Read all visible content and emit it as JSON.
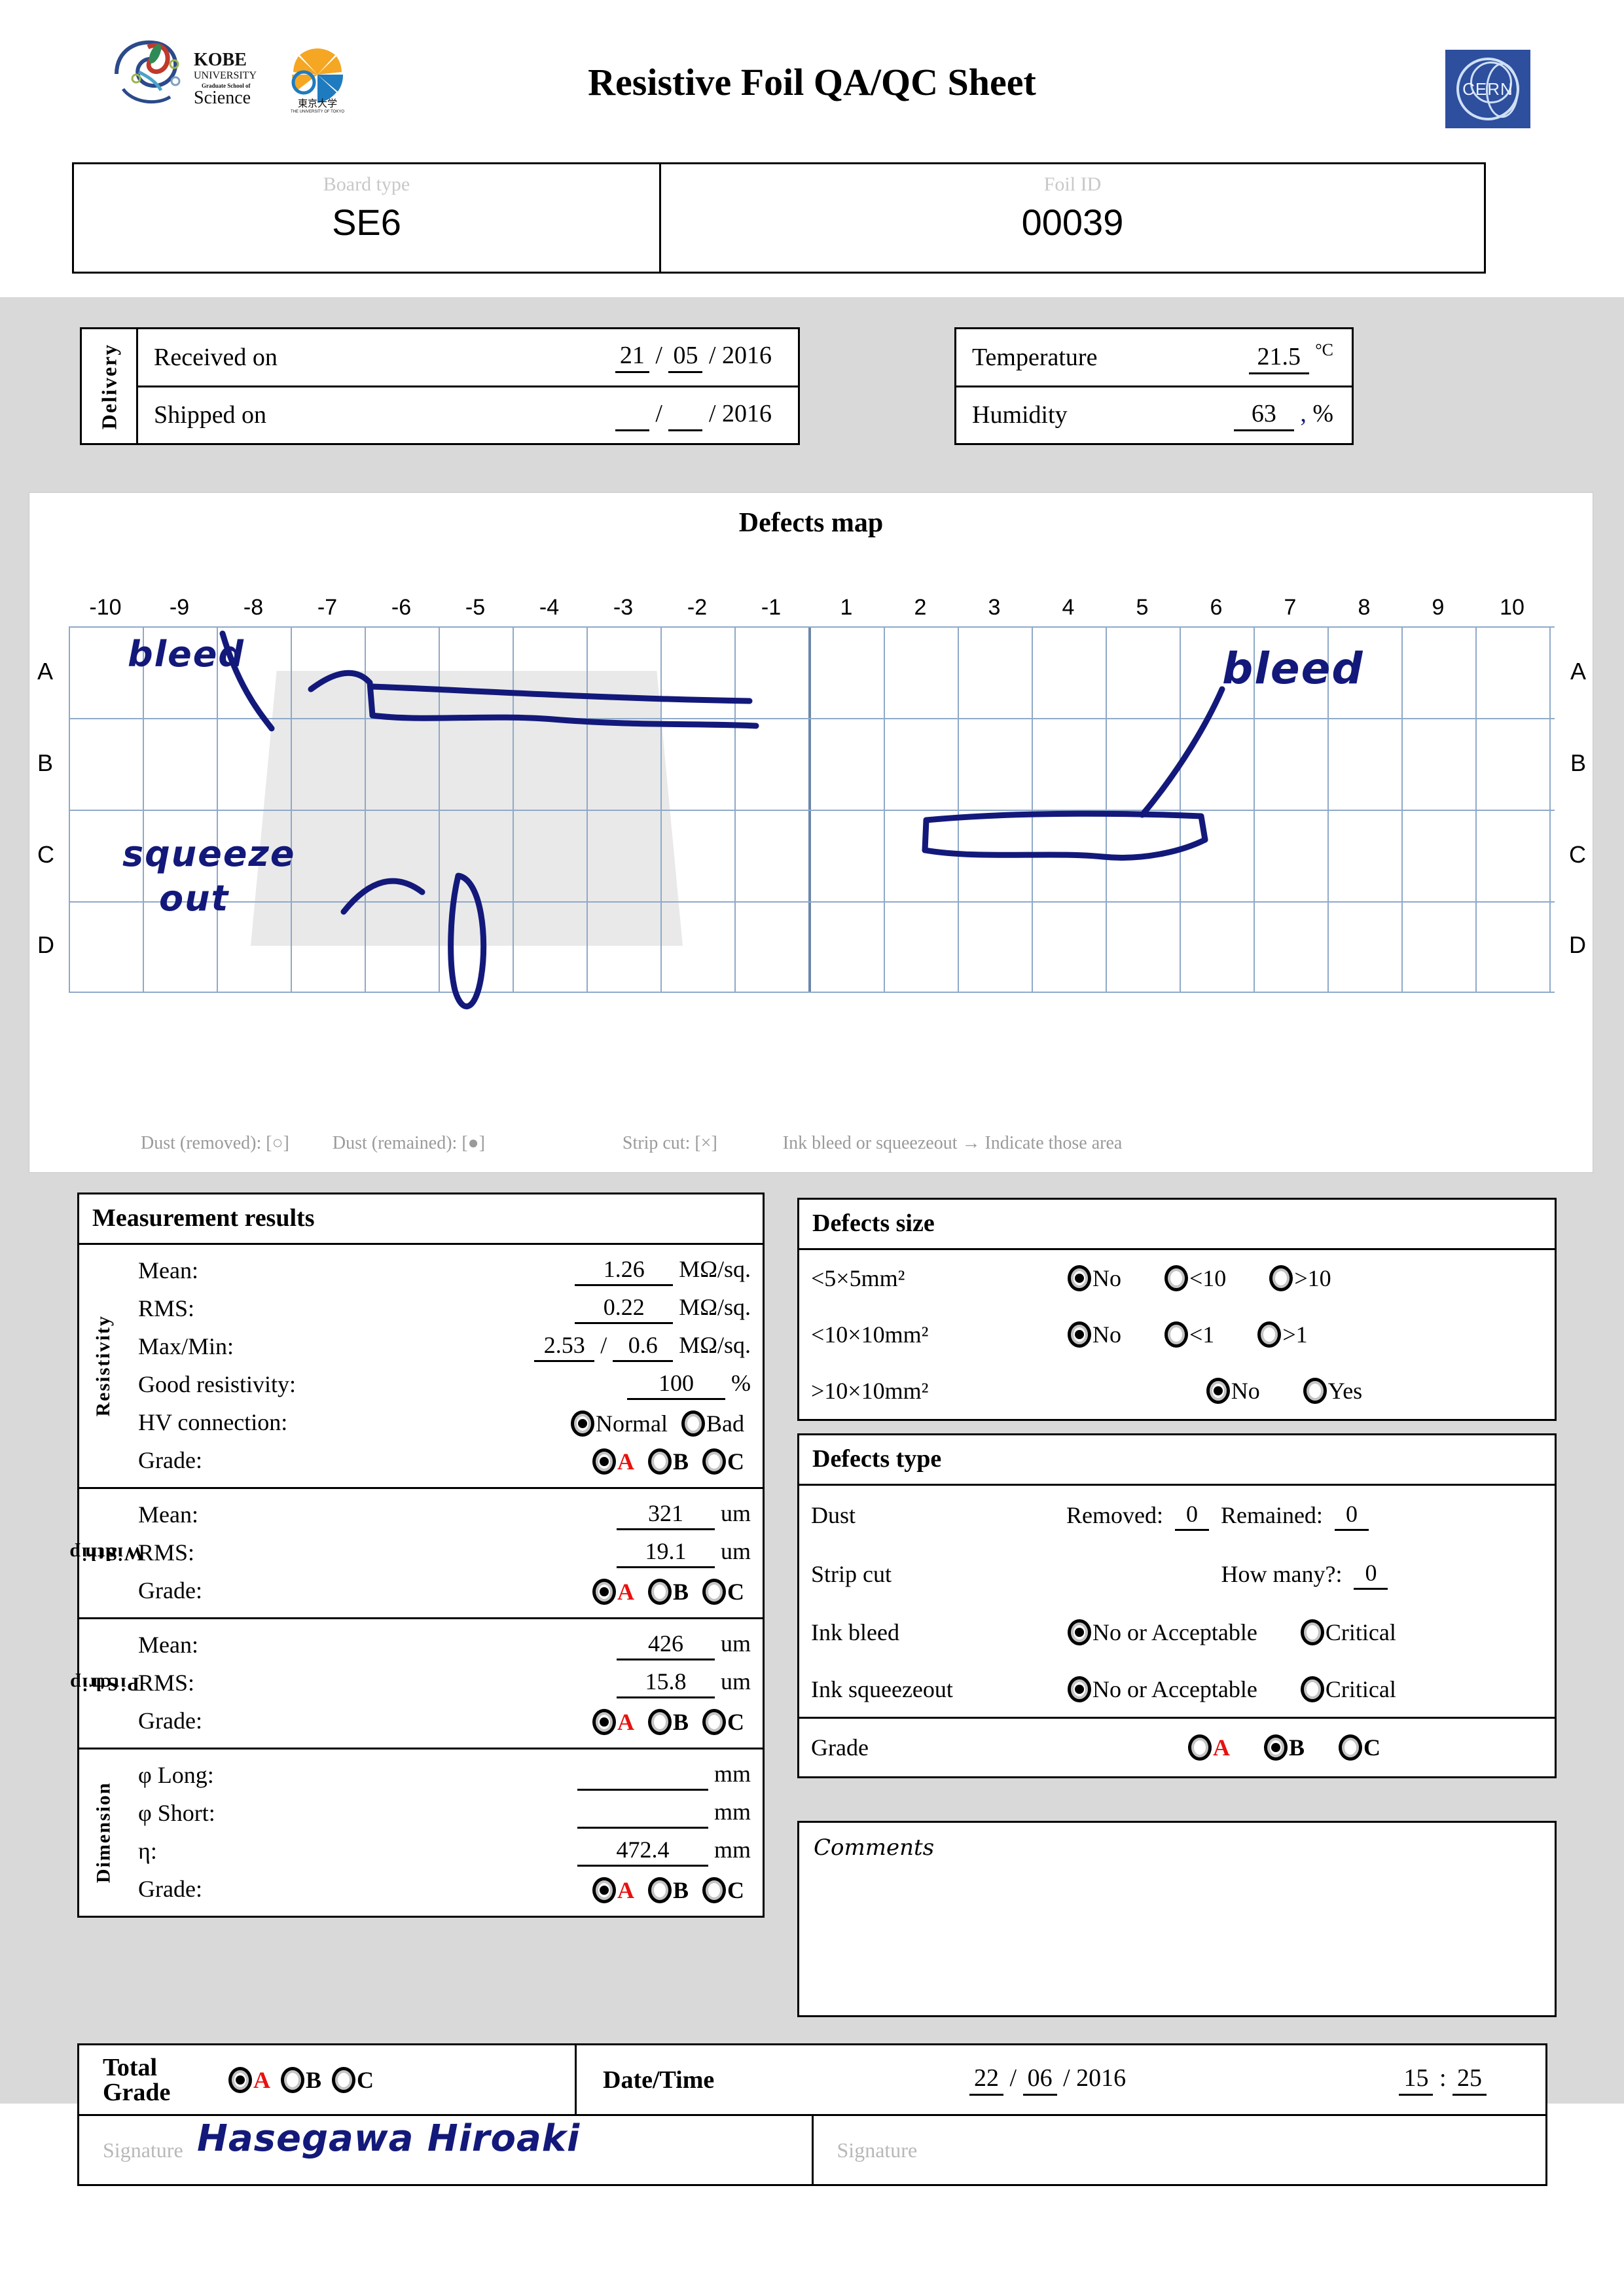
{
  "header": {
    "title": "Resistive Foil QA/QC Sheet",
    "logo_left_name": "kobe-university-graduate-school-of-science-logo",
    "logo_left_text": "KOBE UNIVERSITY Graduate School of Science",
    "logo_mid_name": "university-of-tokyo-logo",
    "logo_mid_text": "東京大学 THE UNIVERSITY OF TOKYO",
    "logo_right_text": "CERN"
  },
  "identification": {
    "board_type_label": "Board type",
    "board_type_value": "SE6",
    "foil_id_label": "Foil ID",
    "foil_id_value": "00039"
  },
  "delivery": {
    "section_label": "Delivery",
    "received_label": "Received on",
    "received_day": "21",
    "received_month": "05",
    "received_year": "2016",
    "shipped_label": "Shipped on",
    "shipped_day": "",
    "shipped_month": "",
    "shipped_year": "2016",
    "slash": "/"
  },
  "environment": {
    "temperature_label": "Temperature",
    "temperature_value": "21.5",
    "temperature_unit": "°C",
    "humidity_label": "Humidity",
    "humidity_value": "63",
    "humidity_ink_mark": ",",
    "humidity_unit": "%"
  },
  "defects_map": {
    "title": "Defects map",
    "columns": [
      "-10",
      "-9",
      "-8",
      "-7",
      "-6",
      "-5",
      "-4",
      "-3",
      "-2",
      "-1",
      "1",
      "2",
      "3",
      "4",
      "5",
      "6",
      "7",
      "8",
      "9",
      "10"
    ],
    "rows": [
      "A",
      "B",
      "C",
      "D"
    ],
    "legend": [
      "Dust (removed): [○]",
      "Dust (remained): [●]",
      "Strip cut: [×]",
      "Ink bleed or squeezeout → Indicate those area"
    ],
    "annotations": [
      {
        "name": "ink-note-bleed-left",
        "text": "bleed"
      },
      {
        "name": "ink-note-squeeze-out",
        "text": "squeeze"
      },
      {
        "name": "ink-note-squeeze-out-2",
        "text": "out"
      },
      {
        "name": "ink-note-bleed-top-right",
        "text": "bleed"
      },
      {
        "name": "ink-note-bleed-bottom",
        "text": "bleed"
      }
    ]
  },
  "measurement": {
    "panel_title": "Measurement results",
    "resistivity": {
      "label": "Resistivity",
      "mean_label": "Mean:",
      "mean_value": "1.26",
      "mean_unit": "MΩ/sq.",
      "rms_label": "RMS:",
      "rms_value": "0.22",
      "rms_unit": "MΩ/sq.",
      "maxmin_label": "Max/Min:",
      "max_value": "2.53",
      "min_value": "0.6",
      "maxmin_unit": "MΩ/sq.",
      "good_label": "Good resistivity:",
      "good_value": "100",
      "good_unit": "%",
      "hv_label": "HV connection:",
      "hv_options": [
        "Normal",
        "Bad"
      ],
      "hv_selected": "Normal",
      "grade_label": "Grade:",
      "grade_options": [
        "A",
        "B",
        "C"
      ],
      "grade_selected": "A"
    },
    "strip_width": {
      "label_line1": "Strip",
      "label_line2": "Width",
      "mean_label": "Mean:",
      "mean_value": "321",
      "mean_unit": "um",
      "rms_label": "RMS:",
      "rms_value": "19.1",
      "rms_unit": "um",
      "grade_label": "Grade:",
      "grade_options": [
        "A",
        "B",
        "C"
      ],
      "grade_selected": "A"
    },
    "strip_pitch": {
      "label_line1": "Strip",
      "label_line2": "Pitch",
      "mean_label": "Mean:",
      "mean_value": "426",
      "mean_unit": "um",
      "rms_label": "RMS:",
      "rms_value": "15.8",
      "rms_unit": "um",
      "grade_label": "Grade:",
      "grade_options": [
        "A",
        "B",
        "C"
      ],
      "grade_selected": "A"
    },
    "dimension": {
      "label": "Dimension",
      "long_label": "φ Long:",
      "long_value": "",
      "long_unit": "mm",
      "short_label": "φ Short:",
      "short_value": "",
      "short_unit": "mm",
      "eta_label": "η:",
      "eta_value": "472.4",
      "eta_unit": "mm",
      "grade_label": "Grade:",
      "grade_options": [
        "A",
        "B",
        "C"
      ],
      "grade_selected": "A"
    }
  },
  "defects_size": {
    "panel_title": "Defects size",
    "rows": [
      {
        "label": "<5×5mm²",
        "options": [
          "No",
          "<10",
          ">10"
        ],
        "selected": "No"
      },
      {
        "label": "<10×10mm²",
        "options": [
          "No",
          "<1",
          ">1"
        ],
        "selected": "No"
      },
      {
        "label": ">10×10mm²",
        "options": [
          "No",
          "Yes"
        ],
        "selected": "No"
      }
    ]
  },
  "defects_type": {
    "panel_title": "Defects type",
    "dust_label": "Dust",
    "dust_removed_label": "Removed:",
    "dust_removed_value": "0",
    "dust_remained_label": "Remained:",
    "dust_remained_value": "0",
    "strip_cut_label": "Strip cut",
    "strip_cut_howmany_label": "How many?:",
    "strip_cut_value": "0",
    "ink_bleed_label": "Ink bleed",
    "ink_bleed_options": [
      "No or Acceptable",
      "Critical"
    ],
    "ink_bleed_selected": "No or Acceptable",
    "ink_squeezeout_label": "Ink squeezeout",
    "ink_squeezeout_options": [
      "No or Acceptable",
      "Critical"
    ],
    "ink_squeezeout_selected": "No or Acceptable",
    "grade_label": "Grade",
    "grade_options": [
      "A",
      "B",
      "C"
    ],
    "grade_selected": "B"
  },
  "comments": {
    "title": "Comments",
    "text": ""
  },
  "footer": {
    "total_grade_line1": "Total",
    "total_grade_line2": "Grade",
    "total_grade_options": [
      "A",
      "B",
      "C"
    ],
    "total_grade_selected": "A",
    "datetime_label": "Date/Time",
    "date_day": "22",
    "date_month": "06",
    "date_year": "2016",
    "time_hour": "15",
    "time_minute": "25",
    "time_sep": ":",
    "signature_label_1": "Signature",
    "signature_value_1": "Hasegawa Hiroaki",
    "signature_label_2": "Signature",
    "signature_value_2": ""
  },
  "colors": {
    "ink": "#13197a",
    "grade_a_red": "#e8110f",
    "body_grey": "#d9d9d9",
    "grid_blue": "#8fa9c8",
    "cern_blue": "#2d4f9e"
  }
}
